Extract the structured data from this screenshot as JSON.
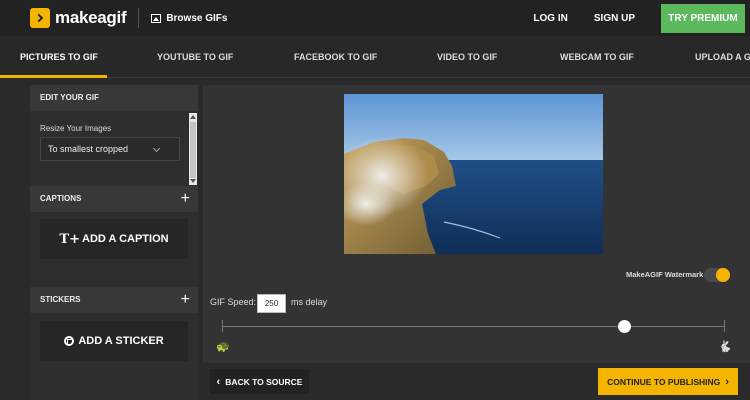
{
  "brand": {
    "name": "makeagif",
    "accent": "#f5b400",
    "premium_color": "#5cb85c"
  },
  "topnav": {
    "browse_label": "Browse GIFs",
    "login_label": "LOG IN",
    "signup_label": "SIGN UP",
    "premium_label": "TRY PREMIUM"
  },
  "tabs": [
    {
      "label": "PICTURES TO GIF",
      "active": true
    },
    {
      "label": "YOUTUBE TO GIF",
      "active": false
    },
    {
      "label": "FACEBOOK TO GIF",
      "active": false
    },
    {
      "label": "VIDEO TO GIF",
      "active": false
    },
    {
      "label": "WEBCAM TO GIF",
      "active": false
    },
    {
      "label": "UPLOAD A GIF",
      "active": false
    }
  ],
  "sidebar": {
    "edit_header": "EDIT YOUR GIF",
    "resize_label": "Resize Your Images",
    "resize_value": "To smallest cropped",
    "captions_header": "CAPTIONS",
    "add_caption_label": "ADD A CAPTION",
    "stickers_header": "STICKERS",
    "add_sticker_label": "ADD A STICKER",
    "plus_symbol": "+"
  },
  "preview": {
    "watermark_label": "MakeAGIF Watermark",
    "watermark_on": true
  },
  "speed": {
    "label": "GIF Speed:",
    "value": "250",
    "unit": "ms delay",
    "slider_fraction": 0.8
  },
  "footer": {
    "back_label": "BACK TO SOURCE",
    "continue_label": "CONTINUE TO PUBLISHING"
  },
  "icons": {
    "back_chevron": "‹",
    "continue_chevron": "›",
    "turtle": "🐢",
    "rabbit": "🐇",
    "caption": "T+"
  }
}
